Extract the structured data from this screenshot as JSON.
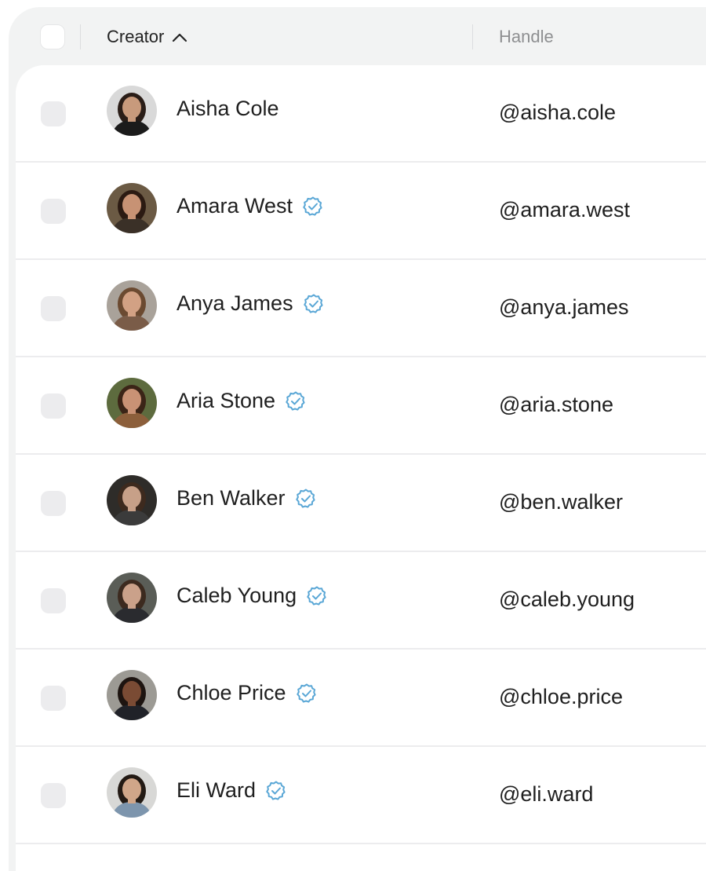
{
  "header": {
    "creator_label": "Creator",
    "handle_label": "Handle",
    "sort_icon": "chevron-up-icon"
  },
  "rows": [
    {
      "name": "Aisha Cole",
      "handle": "@aisha.cole",
      "verified": false,
      "avatar": {
        "bg": "#d9d9d9",
        "skin": "#c89a7c",
        "hair": "#2a1d17",
        "shirt": "#1b1b1b"
      }
    },
    {
      "name": "Amara West",
      "handle": "@amara.west",
      "verified": true,
      "avatar": {
        "bg": "#6b5a44",
        "skin": "#c79274",
        "hair": "#2b1a12",
        "shirt": "#3a3027"
      }
    },
    {
      "name": "Anya James",
      "handle": "@anya.james",
      "verified": true,
      "avatar": {
        "bg": "#a9a29a",
        "skin": "#d2a184",
        "hair": "#6b4a31",
        "shirt": "#7a5c48"
      }
    },
    {
      "name": "Aria Stone",
      "handle": "@aria.stone",
      "verified": true,
      "avatar": {
        "bg": "#5d6b3e",
        "skin": "#c99275",
        "hair": "#3b2417",
        "shirt": "#8c5f3b"
      }
    },
    {
      "name": "Ben Walker",
      "handle": "@ben.walker",
      "verified": true,
      "avatar": {
        "bg": "#2e2c29",
        "skin": "#c7a088",
        "hair": "#3d2a1e",
        "shirt": "#3b3b3b"
      }
    },
    {
      "name": "Caleb Young",
      "handle": "@caleb.young",
      "verified": true,
      "avatar": {
        "bg": "#5a5d57",
        "skin": "#caa18a",
        "hair": "#3c2a1f",
        "shirt": "#2a2b2f"
      }
    },
    {
      "name": "Chloe Price",
      "handle": "@chloe.price",
      "verified": true,
      "avatar": {
        "bg": "#9c9a94",
        "skin": "#7a4b34",
        "hair": "#1d1410",
        "shirt": "#202228"
      }
    },
    {
      "name": "Eli Ward",
      "handle": "@eli.ward",
      "verified": true,
      "avatar": {
        "bg": "#d8d8d6",
        "skin": "#d0a689",
        "hair": "#231a14",
        "shirt": "#7d95ad"
      }
    }
  ],
  "colors": {
    "verified": "#5aa7d6",
    "row_divider": "#ececee",
    "header_bg": "#f2f3f3"
  }
}
